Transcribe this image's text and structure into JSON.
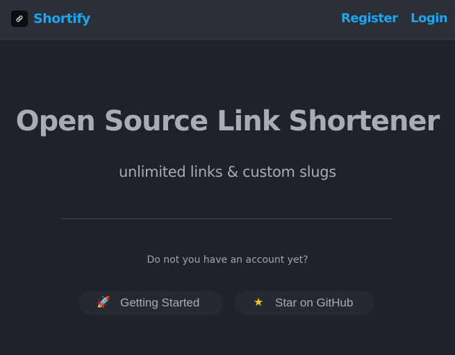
{
  "navbar": {
    "brand": {
      "icon": "link-icon",
      "name": "Shortify"
    },
    "links": {
      "register": "Register",
      "login": "Login"
    },
    "accent_color": "#1fa4f0"
  },
  "hero": {
    "title": "Open Source Link Shortener",
    "subtitle": "unlimited links & custom slugs"
  },
  "cta": {
    "prompt": "Do not you have an account yet?",
    "buttons": {
      "getting_started": {
        "icon": "rocket-icon",
        "label": "Getting Started"
      },
      "github": {
        "icon": "star-icon",
        "label": "Star on GitHub"
      }
    }
  },
  "colors": {
    "background": "#1e232b",
    "navbar": "#2a2f38",
    "text": "#a7acb5"
  }
}
